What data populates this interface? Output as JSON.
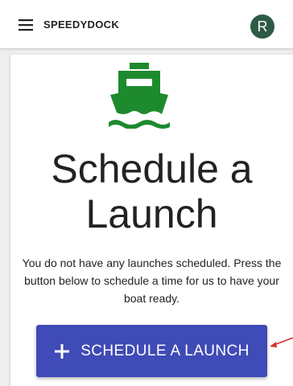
{
  "app_bar": {
    "title": "SPEEDYDOCK",
    "menu_icon": "hamburger-menu-icon",
    "avatar_initial": "R",
    "avatar_color": "#2e5b45"
  },
  "main": {
    "icon": "ferry-boat-icon",
    "icon_color": "#1e8a2e",
    "heading_line1": "Schedule a",
    "heading_line2": "Launch",
    "message": "You do not have any launches scheduled. Press the button below to schedule a time for us to have your boat ready.",
    "cta_button": {
      "label": "SCHEDULE A LAUNCH",
      "icon": "plus-icon",
      "color": "#3f4bb6"
    }
  },
  "annotation": {
    "arrow_color": "#d32f2f"
  }
}
